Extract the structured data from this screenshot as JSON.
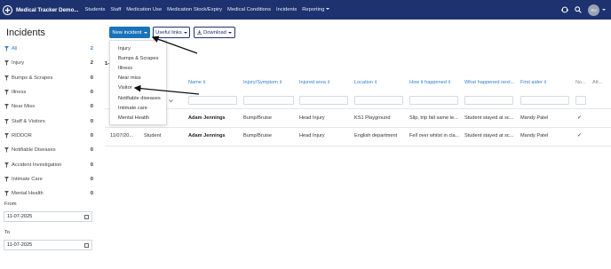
{
  "nav": {
    "brand": "Medical Tracker Demo...",
    "links": [
      "Students",
      "Staff",
      "Medication Use",
      "Medication Stock/Expiry",
      "Medical Conditions",
      "Incidents"
    ],
    "reporting": "Reporting",
    "avatar_initials": "SU"
  },
  "page": {
    "title": "Incidents"
  },
  "sidebar": {
    "items": [
      {
        "label": "All",
        "count": "2"
      },
      {
        "label": "Injury",
        "count": "2"
      },
      {
        "label": "Bumps & Scrapes",
        "count": "0"
      },
      {
        "label": "Illness",
        "count": "0"
      },
      {
        "label": "Near Miss",
        "count": "0"
      },
      {
        "label": "Staff & Visitors",
        "count": "0"
      },
      {
        "label": "RIDDOR",
        "count": "0"
      },
      {
        "label": "Notifiable Diseases",
        "count": "0"
      },
      {
        "label": "Accident Investigation",
        "count": "0"
      },
      {
        "label": "Intimate Care",
        "count": "0"
      },
      {
        "label": "Mental Health",
        "count": "0"
      }
    ],
    "from_label": "From",
    "from_value": "11-07-2025",
    "to_label": "To",
    "to_value": "11-07-2025"
  },
  "toolbar": {
    "new_incident": "New incident",
    "useful_links": "Useful links",
    "download": "Download"
  },
  "dropdown": {
    "items": [
      "Injury",
      "Bumps & Scrapes",
      "Illness",
      "Near miss",
      "Visitor",
      "Notifiable diseases",
      "Intimate care",
      "Mental Health"
    ]
  },
  "table": {
    "row_count_prefix": "1-",
    "headers": [
      "Name",
      "Injury/Symptom",
      "Injured area",
      "Location",
      "How it happened",
      "What happened next...",
      "First aider",
      "No...",
      "Att..."
    ],
    "rows": [
      {
        "date": "",
        "type": "",
        "name": "Adam Jennings",
        "injury": "Bump/Bruise",
        "area": "Head Injury",
        "location": "KS1 Playground",
        "how": "Slip, trip fall same le...",
        "next": "Student stayed at sc...",
        "aider": "Mandy Patel",
        "check": "✓"
      },
      {
        "date": "11/07/20...",
        "type": "Student",
        "name": "Adam Jennings",
        "injury": "Bump/Bruise",
        "area": "Head Injury",
        "location": "English department",
        "how": "Fell over whilst in cla...",
        "next": "Student stayed at sc...",
        "aider": "Mandy Patel",
        "check": "✓"
      }
    ]
  },
  "colors": {
    "navbar": "#1e3270",
    "primary": "#1a73b8",
    "link": "#2f7fd4"
  }
}
